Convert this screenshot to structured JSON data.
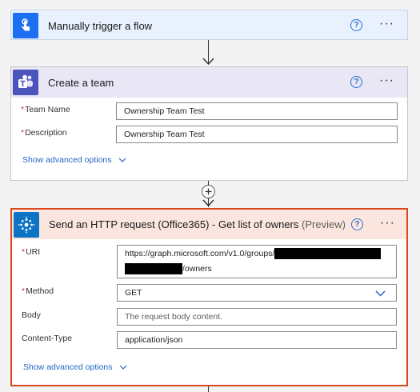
{
  "steps": [
    {
      "title": "Manually trigger a flow",
      "icon": "touch-icon",
      "color": "#1c6ef2",
      "header_bg": "#e8f1fd"
    },
    {
      "title": "Create a team",
      "icon": "teams-icon",
      "color": "#4b53bc",
      "header_bg": "#e9e7f5",
      "fields": [
        {
          "label": "Team Name",
          "required": true,
          "value": "Ownership Team Test"
        },
        {
          "label": "Description",
          "required": true,
          "value": "Ownership Team Test"
        }
      ],
      "advanced_label": "Show advanced options"
    },
    {
      "title": "Send an HTTP request (Office365) - Get list of owners",
      "title_suffix": "(Preview)",
      "icon": "office-graph-icon",
      "color": "#0d74c5",
      "header_bg": "#fbe6df",
      "border_color": "#d9481f",
      "fields": [
        {
          "label": "URI",
          "required": true,
          "value_prefix": "https://graph.microsoft.com/v1.0/groups/",
          "value_suffix": "/owners"
        },
        {
          "label": "Method",
          "required": true,
          "value": "GET"
        },
        {
          "label": "Body",
          "required": false,
          "placeholder": "The request body content."
        },
        {
          "label": "Content-Type",
          "required": false,
          "value": "application/json"
        }
      ],
      "advanced_label": "Show advanced options"
    }
  ],
  "common": {
    "help_glyph": "?",
    "more_glyph": "···",
    "required_mark": "*"
  }
}
